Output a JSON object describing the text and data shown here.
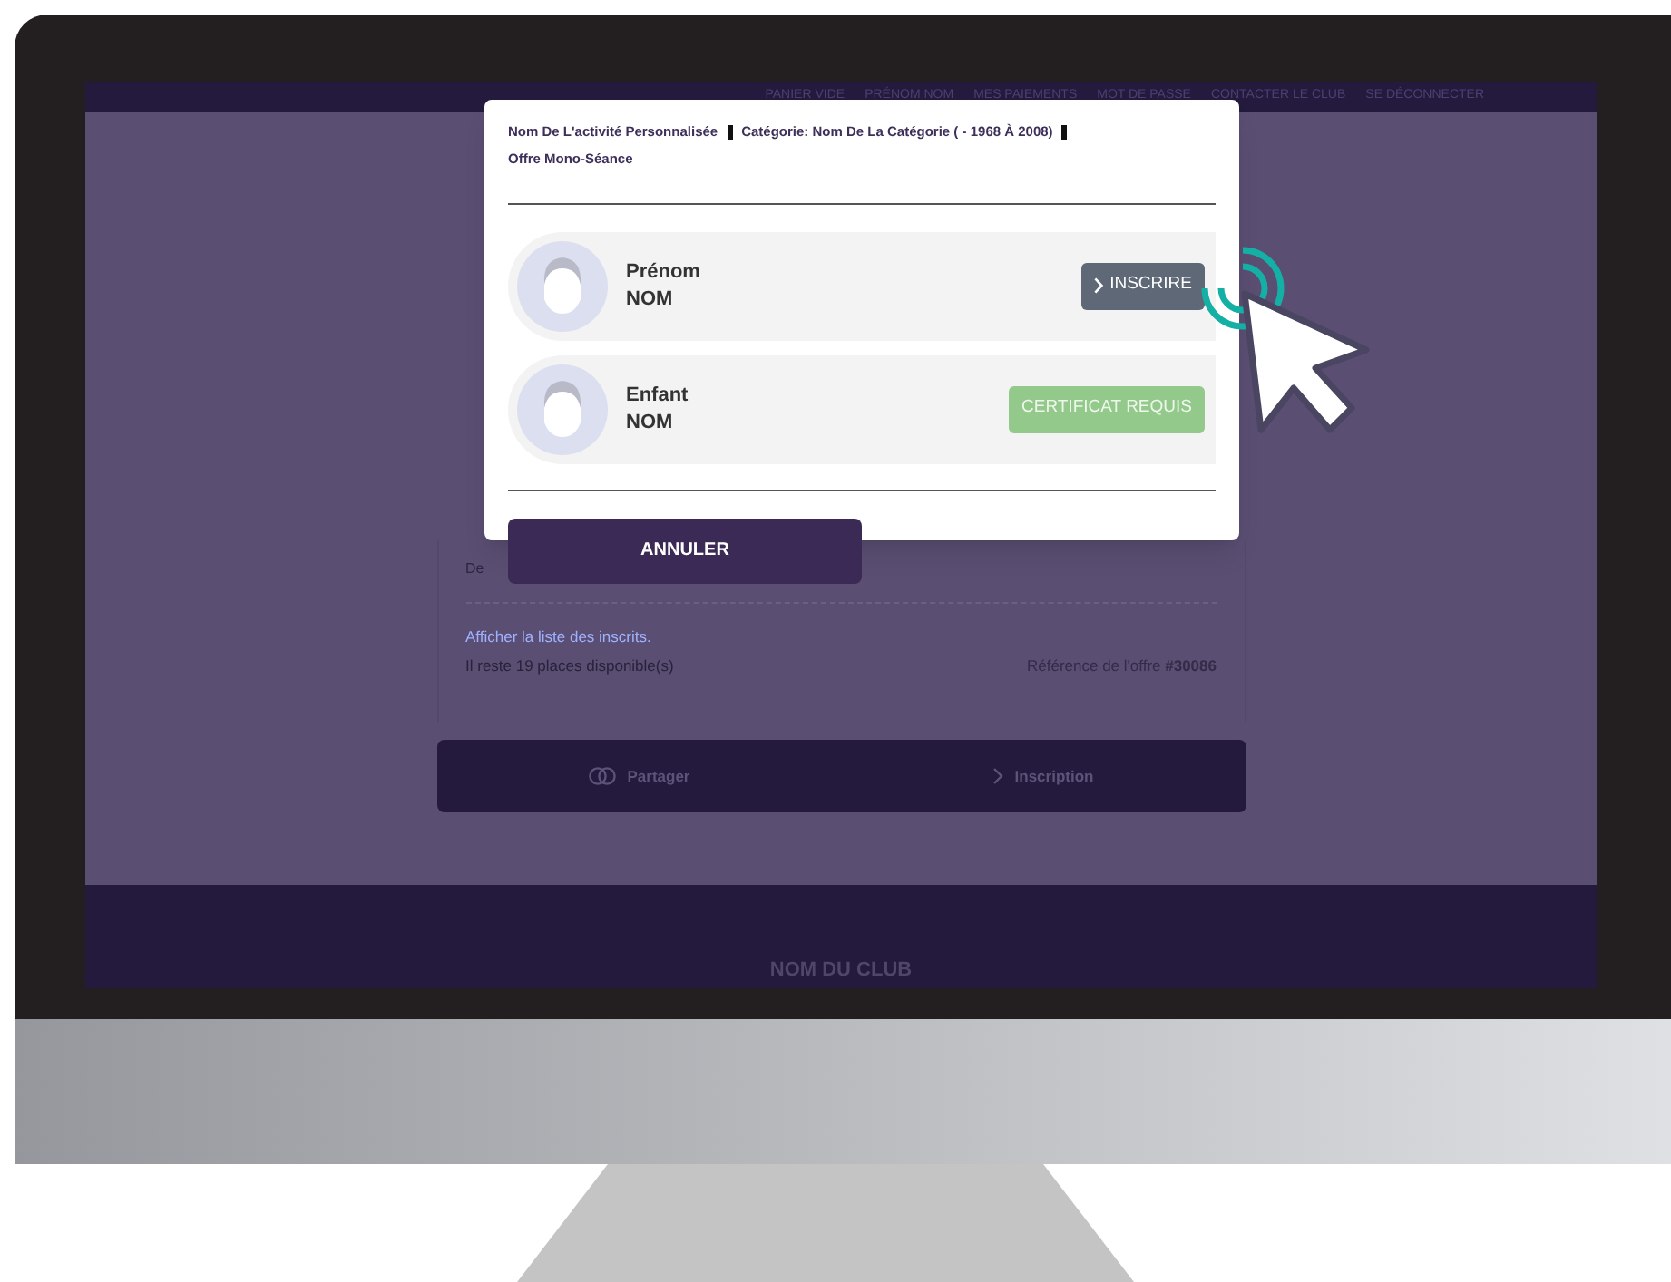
{
  "nav": {
    "links": [
      "PANIER VIDE",
      "PRÉNOM NOM",
      "MES PAIEMENTS",
      "MOT DE PASSE",
      "CONTACTER LE CLUB",
      "SE DÉCONNECTER"
    ]
  },
  "modal": {
    "header": [
      "Nom De L'activité Personnalisée",
      "Catégorie: Nom De La Catégorie ( - 1968 À 2008)"
    ],
    "offer": "Offre Mono-Séance",
    "members": [
      {
        "first_name": "Prénom",
        "last_name": "NOM",
        "action": {
          "kind": "register",
          "label": "INSCRIRE"
        }
      },
      {
        "first_name": "Enfant",
        "last_name": "NOM",
        "action": {
          "kind": "certificate",
          "label": "CERTIFICAT REQUIS"
        }
      }
    ],
    "cancel": "ANNULER"
  },
  "offer_card": {
    "text": "De",
    "link": "Afficher la liste des inscrits.",
    "places": "Il reste 19 places disponible(s)",
    "reference": "Référence de l'offre **#30086**"
  },
  "action_bar": [
    {
      "kind": "share",
      "label": "Partager"
    },
    {
      "kind": "register",
      "label": "Inscription"
    }
  ],
  "footer": {
    "club": "NOM DU CLUB"
  }
}
